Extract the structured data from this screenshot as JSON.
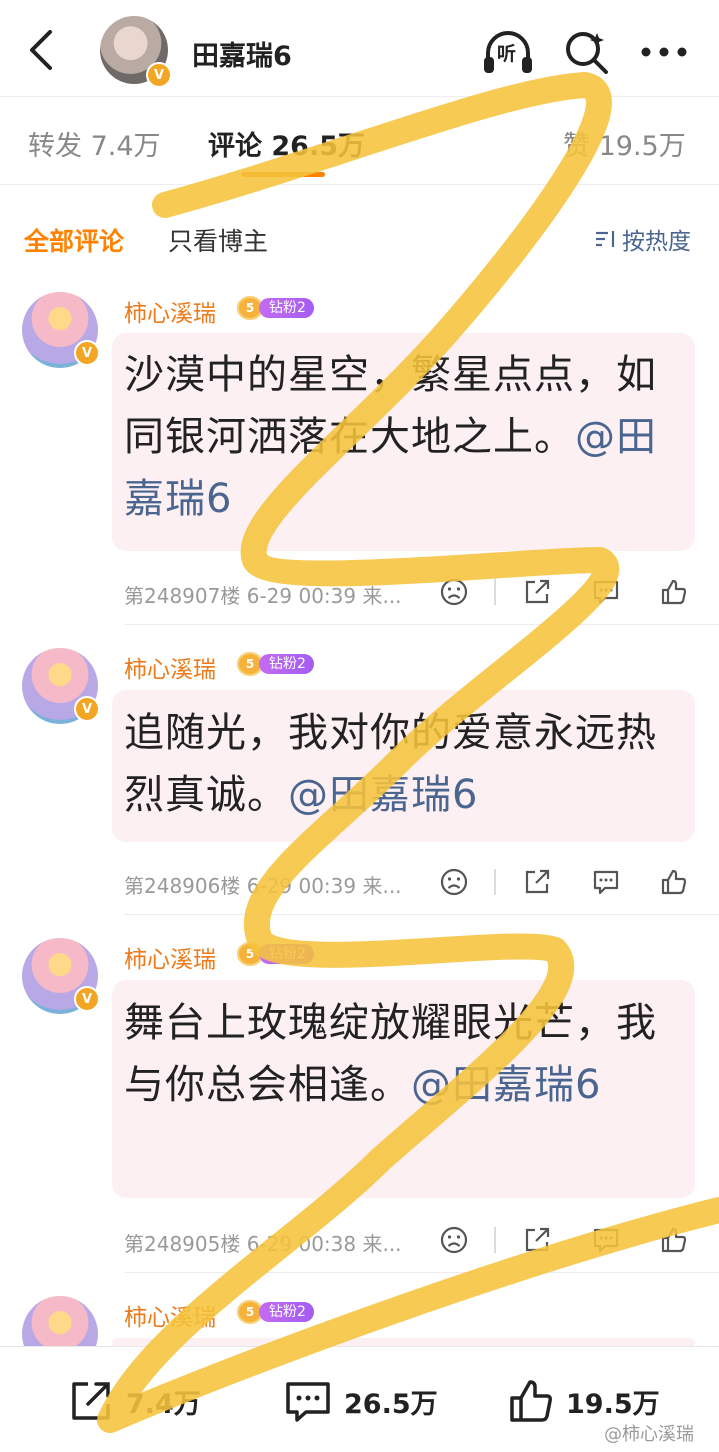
{
  "header": {
    "back_icon": "chevron-left-icon",
    "title": "田嘉瑞6",
    "verified_mark": "V",
    "listen_label": "听",
    "icons": [
      "headphones-icon",
      "search-icon",
      "more-icon"
    ]
  },
  "stats_tabs": [
    {
      "label": "转发 7.4万",
      "active": false
    },
    {
      "label": "评论 26.5万",
      "active": true
    },
    {
      "label": "赞 19.5万",
      "active": false
    }
  ],
  "filters": {
    "all": "全部评论",
    "blogger_only": "只看博主",
    "sort": "按热度"
  },
  "comments": [
    {
      "author": "柿心溪瑞",
      "badge_level": "5",
      "badge_text": "钻粉2",
      "verified_mark": "V",
      "text": "沙漠中的星空，繁星点点，如同银河洒落在大地之上。",
      "mention": "@田嘉瑞6",
      "floor": "第248907楼",
      "time": "6-29 00:39",
      "source": "来..."
    },
    {
      "author": "柿心溪瑞",
      "badge_level": "5",
      "badge_text": "钻粉2",
      "verified_mark": "V",
      "text": "追随光，我对你的爱意永远热烈真诚。",
      "mention": "@田嘉瑞6",
      "floor": "第248906楼",
      "time": "6-29 00:39",
      "source": "来..."
    },
    {
      "author": "柿心溪瑞",
      "badge_level": "5",
      "badge_text": "钻粉2",
      "verified_mark": "V",
      "text": "舞台上玫瑰绽放耀眼光芒，我与你总会相逢。",
      "mention": "@田嘉瑞6",
      "floor": "第248905楼",
      "time": "6-29 00:38",
      "source": "来..."
    },
    {
      "author": "柿心溪瑞",
      "badge_level": "5",
      "badge_text": "钻粉2"
    }
  ],
  "bottom_bar": {
    "repost": "7.4万",
    "comment": "26.5万",
    "like": "19.5万"
  },
  "watermark": "@柿心溪瑞",
  "colors": {
    "accent_orange": "#ff8200",
    "username_orange": "#ee7a1a",
    "link_blue": "#4a6690",
    "bubble_pink": "#fdf0f3",
    "scribble_yellow": "#f5c33b"
  }
}
